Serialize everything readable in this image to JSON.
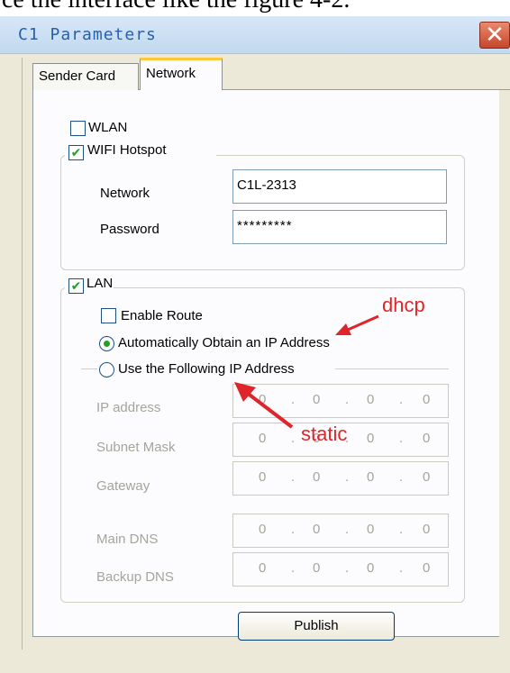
{
  "document_snippet": "ce the interface like the figure 4-2.",
  "window": {
    "title": "C1 Parameters",
    "close_glyph": "✕"
  },
  "tabs": [
    {
      "label": "Sender Card",
      "selected": false
    },
    {
      "label": "Network",
      "selected": true
    }
  ],
  "wlan": {
    "label": "WLAN",
    "checked": false
  },
  "wifi_hotspot": {
    "label": "WIFI Hotspot",
    "checked": true,
    "network_label": "Network",
    "network_value": "C1L-2313",
    "password_label": "Password",
    "password_value": "*********"
  },
  "lan": {
    "label": "LAN",
    "checked": true,
    "enable_route": {
      "label": "Enable Route",
      "checked": false
    },
    "auto_ip": {
      "label": "Automatically Obtain an IP Address",
      "selected": true
    },
    "manual_ip": {
      "label": "Use the Following IP Address",
      "selected": false
    },
    "fields": [
      {
        "label": "IP address",
        "octets": [
          "0",
          "0",
          "0",
          "0"
        ]
      },
      {
        "label": "Subnet Mask",
        "octets": [
          "0",
          "0",
          "0",
          "0"
        ]
      },
      {
        "label": "Gateway",
        "octets": [
          "0",
          "0",
          "0",
          "0"
        ]
      },
      {
        "label": "Main DNS",
        "octets": [
          "0",
          "0",
          "0",
          "0"
        ]
      },
      {
        "label": "Backup DNS",
        "octets": [
          "0",
          "0",
          "0",
          "0"
        ]
      }
    ]
  },
  "publish_button": "Publish",
  "annotations": {
    "dhcp": "dhcp",
    "static": "static",
    "color": "#e0252a"
  },
  "checkmark_glyph": "✔",
  "colors": {
    "window_bg": "#ece9d8",
    "panel_bg": "#fcfcfe",
    "title_text": "#2a5fa8",
    "close_button": "#c6452a",
    "selected_tab_accent": "#ffc83c",
    "check_green": "#21a121",
    "disabled_text": "#a5a59c"
  }
}
